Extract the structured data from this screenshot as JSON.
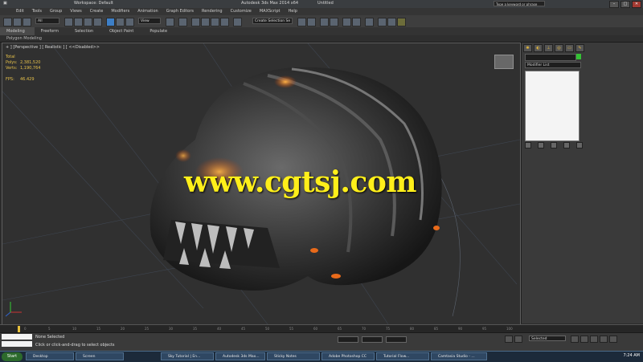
{
  "window": {
    "workspace": "Workspace: Default",
    "title_center": "Autodesk 3ds Max 2014 x64",
    "title_file": "Untitled",
    "search_placeholder": "Type a keyword or phrase"
  },
  "menu": [
    "Edit",
    "Tools",
    "Group",
    "Views",
    "Create",
    "Modifiers",
    "Animation",
    "Graph Editors",
    "Rendering",
    "Customize",
    "MAXScript",
    "Help"
  ],
  "toolbar": {
    "selection_filter": "All",
    "view_dropdown": "View",
    "named_selection": "Create Selection Se"
  },
  "ribbon": {
    "tabs": [
      "Modeling",
      "Freeform",
      "Selection",
      "Object Paint",
      "Populate"
    ],
    "active": "Modeling",
    "sub": "Polygon Modeling"
  },
  "viewport": {
    "label": "+ ] [Perspective ] [ Realistic ] [ <<Disabled>>",
    "stats": [
      {
        "name": "Total",
        "value": ""
      },
      {
        "name": "Polys:",
        "value": "2,381,520"
      },
      {
        "name": "Verts:",
        "value": "1,190,764"
      },
      {
        "name": "FPS:",
        "value": "46.429"
      }
    ],
    "watermark": "www.cgtsj.com"
  },
  "command_panel": {
    "modifier_list": "Modifier List"
  },
  "timeline": {
    "ticks": [
      "0",
      "5",
      "10",
      "15",
      "20",
      "25",
      "30",
      "35",
      "40",
      "45",
      "50",
      "55",
      "60",
      "65",
      "70",
      "75",
      "80",
      "85",
      "90",
      "95",
      "100"
    ]
  },
  "status": {
    "line1": "None Selected",
    "line2": "Click or click-and-drag to select objects",
    "key_mode": "Selected"
  },
  "taskbar": {
    "start": "Start",
    "items": [
      "Desktop",
      "Screen",
      "Sky Tutorial | En...",
      "Autodesk 3ds Max...",
      "Sticky Notes",
      "Adobe Photoshop CC",
      "Tutorial Flow...",
      "Camtasia Studio - ..."
    ],
    "clock": "7:24 AM"
  },
  "colors": {
    "watermark": "#ffef1a",
    "accent": "#e8c13c",
    "object_color": "#34c234"
  }
}
